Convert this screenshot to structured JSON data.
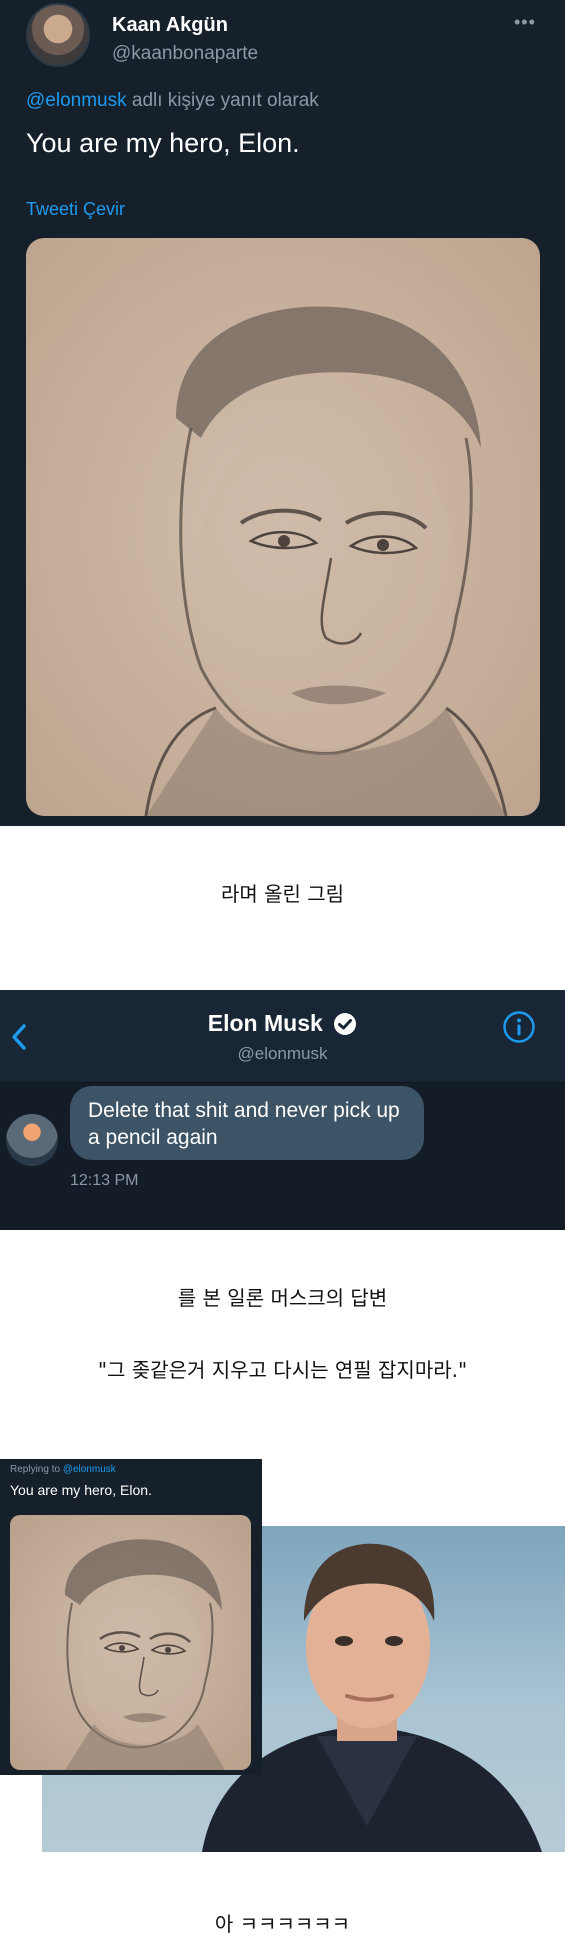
{
  "tweet": {
    "display_name": "Kaan Akgün",
    "handle": "@kaanbonaparte",
    "more_icon": "more-dots-icon",
    "reply_mention": "@elonmusk",
    "reply_suffix": " adlı kişiye yanıt olarak",
    "text": "You are my hero, Elon.",
    "translate_label": "Tweeti Çevir",
    "image": "pencil-sketch-portrait"
  },
  "captions": {
    "first": "라며 올린 그림",
    "second": "를 본 일론 머스크의 답변",
    "third": "\"그 좆같은거 지우고 다시는 연필 잡지마라.\"",
    "last": "아 ㅋㅋㅋㅋㅋㅋ"
  },
  "dm": {
    "name": "Elon Musk",
    "handle": "@elonmusk",
    "back_icon": "chevron-left-icon",
    "verified_icon": "verified-badge-icon",
    "info_icon": "info-icon",
    "message": "Delete that shit and never pick up a pencil again",
    "time": "12:13 PM"
  },
  "comparison": {
    "reply_prefix": "Replying to ",
    "reply_mention": "@elonmusk",
    "text": "You are my hero, Elon.",
    "photo": "elon-musk-photo"
  },
  "colors": {
    "twitter_dark_bg": "#15202b",
    "link_blue": "#1d9bf0",
    "muted_gray": "#8b98a5",
    "bubble": "#3d5466"
  }
}
